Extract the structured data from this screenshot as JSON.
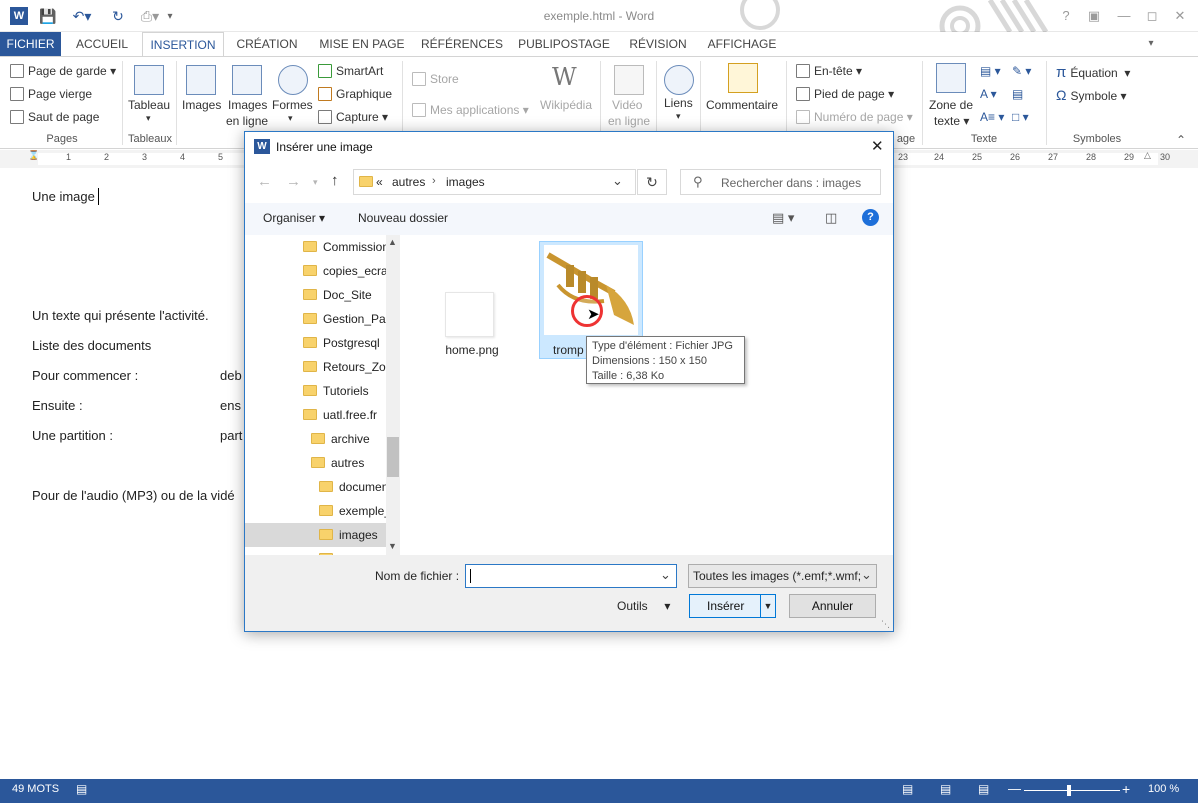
{
  "window": {
    "title": "exemple.html - Word"
  },
  "tabs": [
    "FICHIER",
    "ACCUEIL",
    "INSERTION",
    "CRÉATION",
    "MISE EN PAGE",
    "RÉFÉRENCES",
    "PUBLIPOSTAGE",
    "RÉVISION",
    "AFFICHAGE"
  ],
  "ribbon": {
    "pages": {
      "page_de_garde": "Page de garde",
      "page_vierge": "Page vierge",
      "saut_de_page": "Saut de page",
      "label": "Pages"
    },
    "tableaux": {
      "tableau": "Tableau",
      "label": "Tableaux"
    },
    "illustrations": {
      "images": "Images",
      "images_en_ligne_1": "Images",
      "images_en_ligne_2": "en ligne",
      "formes": "Formes",
      "smartart": "SmartArt",
      "graphique": "Graphique",
      "capture": "Capture"
    },
    "apps": {
      "store": "Store",
      "mes_applications": "Mes applications",
      "wikipedia": "Wikipédia"
    },
    "media": {
      "video_1": "Vidéo",
      "video_2": "en ligne"
    },
    "liens": "Liens",
    "commentaire": "Commentaire",
    "entete": {
      "en_tete": "En-tête",
      "pied_de_page": "Pied de page",
      "numero_de_page": "Numéro de page",
      "label_tail": "age"
    },
    "texte": {
      "zone_1": "Zone de",
      "zone_2": "texte",
      "label": "Texte"
    },
    "symboles": {
      "equation": "Équation",
      "symbole": "Symbole",
      "label": "Symboles"
    }
  },
  "ruler": [
    "1",
    "2",
    "3",
    "4",
    "5",
    "23",
    "24",
    "25",
    "26",
    "27",
    "28",
    "29",
    "30"
  ],
  "document": {
    "line1": "Une image",
    "line2": "Un texte qui présente l'activité.",
    "line3": "Liste des documents",
    "line4a": "Pour commencer :",
    "line4b": "deb",
    "line5a": "Ensuite :",
    "line5b": "ens",
    "line6a": "Une partition :",
    "line6b": "part",
    "line7": "Pour de l'audio (MP3) ou de la vidé"
  },
  "dialog": {
    "title": "Insérer une image",
    "address": {
      "prefix": "«",
      "crumb1": "autres",
      "crumb2": "images"
    },
    "search_placeholder": "Rechercher dans : images",
    "organiser": "Organiser",
    "nouveau_dossier": "Nouveau dossier",
    "nav_items": [
      "Commission",
      "copies_ecra",
      "Doc_Site",
      "Gestion_Pag",
      "Postgresql",
      "Retours_Zoo",
      "Tutoriels",
      "uatl.free.fr",
      "archive",
      "autres",
      "documen",
      "exemple_",
      "images"
    ],
    "files": [
      {
        "name": "home.png"
      },
      {
        "name": "tromp"
      }
    ],
    "tooltip": {
      "type": "Type d'élément : Fichier JPG",
      "dimensions": "Dimensions : 150 x 150",
      "taille": "Taille : 6,38 Ko"
    },
    "filename_label": "Nom de fichier :",
    "filename_value": "",
    "filter": "Toutes les images (*.emf;*.wmf;",
    "outils": "Outils",
    "inserer": "Insérer",
    "annuler": "Annuler"
  },
  "status": {
    "words": "49 MOTS",
    "zoom": "100 %"
  },
  "colors": {
    "accent": "#2b579a",
    "dialog_border": "#2b78c6"
  }
}
